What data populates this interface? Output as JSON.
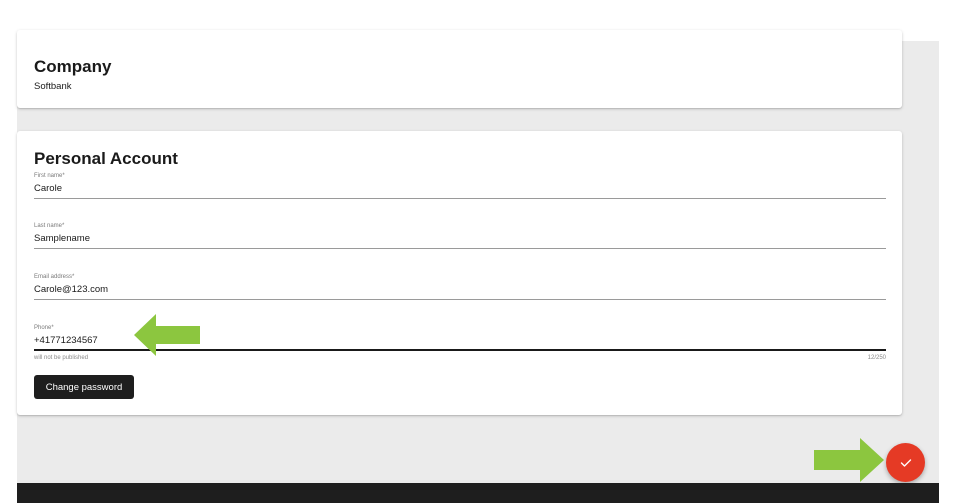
{
  "company": {
    "title": "Company",
    "value": "Softbank"
  },
  "personal_account": {
    "title": "Personal Account",
    "fields": [
      {
        "label": "First name*",
        "value": "Carole"
      },
      {
        "label": "Last name*",
        "value": "Samplename"
      },
      {
        "label": "Email address*",
        "value": "Carole@123.com"
      },
      {
        "label": "Phone*",
        "value": "+41771234567",
        "hint": "will not be published",
        "counter": "12/250"
      }
    ],
    "change_password_label": "Change password"
  },
  "save_fab": {
    "icon": "check-icon"
  },
  "annotations": {
    "arrow_color": "#8cc63f"
  },
  "colors": {
    "fab": "#e53a25",
    "button_dark": "#1e1e1e",
    "page_bg": "#ebebeb"
  }
}
